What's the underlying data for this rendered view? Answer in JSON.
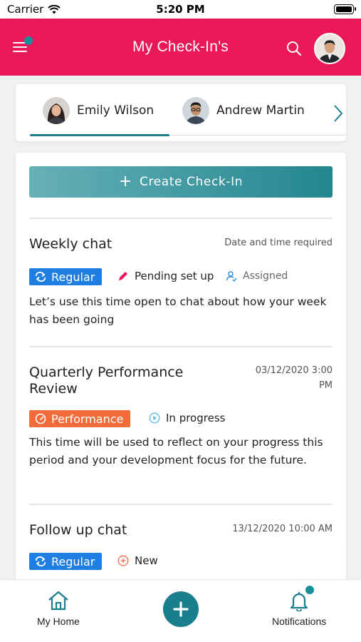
{
  "status_bar": {
    "carrier": "Carrier",
    "time": "5:20 PM"
  },
  "header": {
    "title": "My Check-In's"
  },
  "people": [
    {
      "name": "Emily Wilson",
      "active": true
    },
    {
      "name": "Andrew Martin",
      "active": false
    }
  ],
  "actions": {
    "create_label": "Create Check-In"
  },
  "checkins": [
    {
      "title": "Weekly chat",
      "meta": "Date and time required",
      "type": "Regular",
      "status": "Pending set up",
      "assignment": "Assigned",
      "description": "Let’s use this time open to chat about how your week has been going"
    },
    {
      "title": "Quarterly Performance Review",
      "meta": "03/12/2020 3:00 PM",
      "type": "Performance",
      "status": "In progress",
      "description": "This time will be used to reflect on your progress this period and your development focus for the future."
    },
    {
      "title": "Follow up chat",
      "meta": "13/12/2020 10:00 AM",
      "type": "Regular",
      "status": "New"
    }
  ],
  "bottom_nav": {
    "home_label": "My Home",
    "notifications_label": "Notifications"
  },
  "colors": {
    "header": "#e8185a",
    "teal": "#1a7f8c",
    "regular_badge": "#1f7fe0",
    "performance_badge": "#f26b3a"
  }
}
